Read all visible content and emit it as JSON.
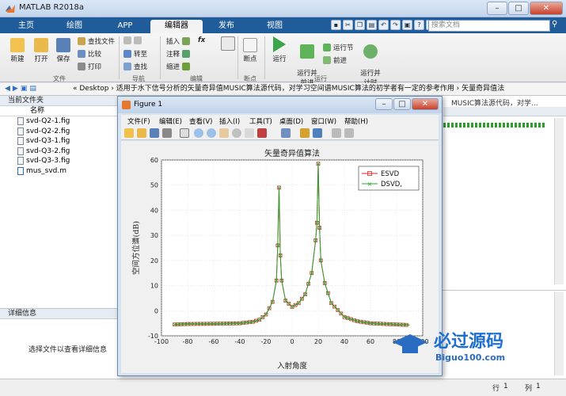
{
  "window": {
    "title": "MATLAB R2018a",
    "buttons": [
      "–",
      "□",
      "✕"
    ]
  },
  "tabs": [
    {
      "label": "主页",
      "active": false
    },
    {
      "label": "绘图",
      "active": false
    },
    {
      "label": "APP",
      "active": false
    },
    {
      "label": "编辑器",
      "active": true
    },
    {
      "label": "发布",
      "active": false
    },
    {
      "label": "视图",
      "active": false
    }
  ],
  "search": {
    "placeholder": "搜索文档"
  },
  "ribbon": {
    "new": "新建",
    "open": "打开",
    "save": "保存",
    "find_files": "查找文件",
    "compare": "比较",
    "print": "打印",
    "goto": "转至",
    "find": "查找",
    "insert": "插入",
    "comment": "注释",
    "indent": "缩进",
    "fx": "fx",
    "breakpoints": "断点",
    "run": "运行",
    "run_advance": "运行并\n前进",
    "run_section": "运行节",
    "advance": "前进",
    "run_time": "运行并\n计时",
    "groups": {
      "file": "文件",
      "nav": "导航",
      "edit": "编辑",
      "bp": "断点",
      "run": "运行"
    }
  },
  "address": {
    "path": "« Desktop  ›  适用于水下信号分析的矢量奇异值MUSIC算法源代码，对学习空间谱MUSIC算法的初学者有一定的参考作用  ›  矢量奇异值法"
  },
  "left": {
    "header": "当前文件夹",
    "column": "名称",
    "files": [
      "svd-Q2-1.fig",
      "svd-Q2-2.fig",
      "svd-Q3-1.fig",
      "svd-Q3-2.fig",
      "svd-Q3-3.fig",
      "mus_svd.m"
    ],
    "details_header": "详细信息",
    "details_msg": "选择文件以查看详细信息"
  },
  "editor": {
    "behind_text": "MUSIC算法源代码，对学..."
  },
  "status": {
    "row_label": "行",
    "row": "1",
    "col_label": "列",
    "col": "1"
  },
  "figure": {
    "title": "Figure 1",
    "menus": [
      "文件(F)",
      "编辑(E)",
      "查看(V)",
      "插入(I)",
      "工具(T)",
      "桌面(D)",
      "窗口(W)",
      "帮助(H)"
    ]
  },
  "watermark": {
    "text": "必过源码",
    "sub": "Biguo100.com"
  },
  "chart_data": {
    "type": "line",
    "title": "矢量奇异值算法",
    "xlabel": "入射角度",
    "ylabel": "空间方位谱(dB)",
    "xlim": [
      -100,
      100
    ],
    "ylim": [
      -10,
      60
    ],
    "xticks": [
      -100,
      -80,
      -60,
      -40,
      -20,
      0,
      20,
      40,
      60,
      80,
      100
    ],
    "yticks": [
      -10,
      0,
      10,
      20,
      30,
      40,
      50,
      60
    ],
    "grid": true,
    "legend": "top-right",
    "series": [
      {
        "name": "ESVD",
        "color": "#d62728",
        "marker": "square",
        "x": [
          -90,
          -80,
          -60,
          -40,
          -30,
          -25,
          -20,
          -15,
          -12,
          -11,
          -10,
          -9,
          -8,
          -5,
          0,
          5,
          10,
          15,
          18,
          19,
          20,
          21,
          22,
          25,
          30,
          40,
          50,
          60,
          80,
          90
        ],
        "y": [
          -5.5,
          -5.3,
          -5.2,
          -5,
          -4.4,
          -3.6,
          -1.5,
          3.5,
          12,
          26,
          49,
          22,
          12,
          4,
          1.5,
          3,
          6.5,
          15,
          28,
          35,
          58.5,
          33,
          20,
          11,
          3,
          -2.5,
          -4.2,
          -5,
          -5.5,
          -5.7
        ]
      },
      {
        "name": "DSVD,",
        "color": "#2ca02c",
        "marker": "x",
        "x": [
          -90,
          -80,
          -60,
          -40,
          -30,
          -25,
          -20,
          -15,
          -12,
          -11,
          -10,
          -9,
          -8,
          -5,
          0,
          5,
          10,
          15,
          18,
          19,
          20,
          21,
          22,
          25,
          30,
          40,
          50,
          60,
          80,
          90
        ],
        "y": [
          -5.5,
          -5.3,
          -5.2,
          -5,
          -4.4,
          -3.6,
          -1.5,
          3.5,
          12,
          26,
          49,
          22,
          12,
          4,
          1.5,
          3,
          6.5,
          15,
          28,
          35,
          58.5,
          33,
          20,
          11,
          3,
          -2.5,
          -4.2,
          -5,
          -5.5,
          -5.7
        ]
      }
    ]
  }
}
